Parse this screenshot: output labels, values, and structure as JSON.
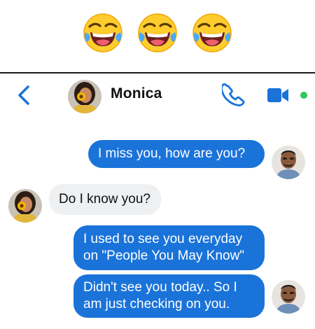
{
  "emojis": [
    {
      "icon": "face-with-tears-of-joy-icon"
    },
    {
      "icon": "face-with-tears-of-joy-icon"
    },
    {
      "icon": "face-with-tears-of-joy-icon"
    }
  ],
  "header": {
    "back_icon": "chevron-left-icon",
    "contact_name": "Monica",
    "phone_icon": "phone-icon",
    "video_icon": "video-camera-icon",
    "online_status_color": "#31c75a"
  },
  "messages": [
    {
      "direction": "outgoing",
      "text": "I miss you, how are you?"
    },
    {
      "direction": "incoming",
      "text": "Do I know you?"
    },
    {
      "direction": "outgoing",
      "text": "I used to see you everyday\non \"People You May Know\""
    },
    {
      "direction": "outgoing",
      "text": "Didn't see you today.. So I\nam just checking on you."
    }
  ],
  "colors": {
    "accent": "#1a73d9",
    "incoming_bubble": "#eef0f2",
    "outgoing_text": "#ffffff"
  }
}
